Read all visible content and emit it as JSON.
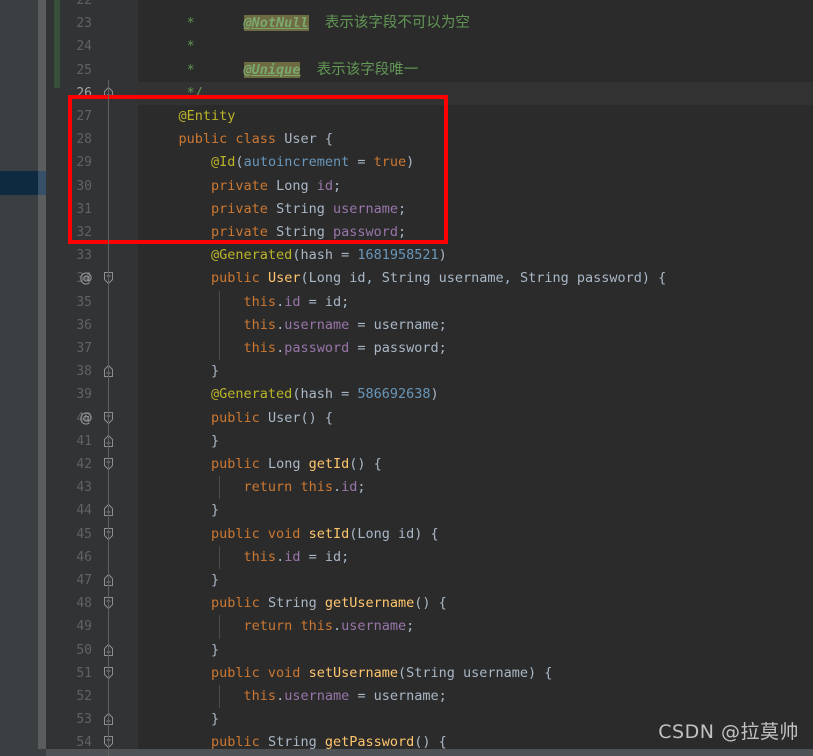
{
  "editor": {
    "theme_name": "darcula",
    "background": "#2b2b2b",
    "gutter_background": "#313335",
    "accent_highlight": "#0e2a41",
    "annotation_box_color": "#fe0000",
    "change_marker_color": "#375039",
    "caret_line_color": "#323232"
  },
  "watermark": {
    "text": "CSDN @拉莫帅"
  },
  "annotation_box": {
    "name": "red-highlight-rectangle",
    "starts_at_line": 27,
    "ends_at_line": 32,
    "color": "#fe0000"
  },
  "lines": [
    {
      "number": "22",
      "at_marker": "",
      "fold": "",
      "caret": false,
      "indent_guides": [],
      "tokens": [
        {
          "text": "     *",
          "cls": "cmt"
        }
      ]
    },
    {
      "number": "23",
      "at_marker": "",
      "fold": "",
      "caret": false,
      "indent_guides": [],
      "tokens": [
        {
          "text": "     *      ",
          "cls": "cmt"
        },
        {
          "text": "@NotNull",
          "cls": "cmt-tag"
        },
        {
          "text": "  ",
          "cls": "cmt"
        },
        {
          "text": "表示该字段不可以为空",
          "cls": "cmt-cjk"
        }
      ]
    },
    {
      "number": "24",
      "at_marker": "",
      "fold": "",
      "caret": false,
      "indent_guides": [],
      "tokens": [
        {
          "text": "     *",
          "cls": "cmt"
        }
      ]
    },
    {
      "number": "25",
      "at_marker": "",
      "fold": "",
      "caret": false,
      "indent_guides": [],
      "tokens": [
        {
          "text": "     *      ",
          "cls": "cmt"
        },
        {
          "text": "@Unique",
          "cls": "cmt-tag"
        },
        {
          "text": "  ",
          "cls": "cmt"
        },
        {
          "text": "表示该字段唯一",
          "cls": "cmt-cjk"
        }
      ]
    },
    {
      "number": "26",
      "at_marker": "",
      "fold": "collapse-end",
      "caret": true,
      "indent_guides": [],
      "tokens": [
        {
          "text": "     */",
          "cls": "cmt"
        }
      ]
    },
    {
      "number": "27",
      "at_marker": "",
      "fold": "",
      "caret": false,
      "indent_guides": [],
      "tokens": [
        {
          "text": "    ",
          "cls": "pln"
        },
        {
          "text": "@Entity",
          "cls": "ann"
        }
      ]
    },
    {
      "number": "28",
      "at_marker": "",
      "fold": "",
      "caret": false,
      "indent_guides": [],
      "tokens": [
        {
          "text": "    ",
          "cls": "pln"
        },
        {
          "text": "public class ",
          "cls": "kw"
        },
        {
          "text": "User ",
          "cls": "typ"
        },
        {
          "text": "{",
          "cls": "pln"
        }
      ]
    },
    {
      "number": "29",
      "at_marker": "",
      "fold": "",
      "caret": false,
      "indent_guides": [],
      "tokens": [
        {
          "text": "        ",
          "cls": "pln"
        },
        {
          "text": "@Id",
          "cls": "ann"
        },
        {
          "text": "(",
          "cls": "pln"
        },
        {
          "text": "autoincrement",
          "cls": "num"
        },
        {
          "text": " = ",
          "cls": "pln"
        },
        {
          "text": "true",
          "cls": "kw"
        },
        {
          "text": ")",
          "cls": "pln"
        }
      ]
    },
    {
      "number": "30",
      "at_marker": "",
      "fold": "",
      "caret": false,
      "indent_guides": [],
      "tokens": [
        {
          "text": "        ",
          "cls": "pln"
        },
        {
          "text": "private ",
          "cls": "kw"
        },
        {
          "text": "Long ",
          "cls": "typ"
        },
        {
          "text": "id",
          "cls": "fld"
        },
        {
          "text": ";",
          "cls": "pln"
        }
      ]
    },
    {
      "number": "31",
      "at_marker": "",
      "fold": "",
      "caret": false,
      "indent_guides": [],
      "tokens": [
        {
          "text": "        ",
          "cls": "pln"
        },
        {
          "text": "private ",
          "cls": "kw"
        },
        {
          "text": "String ",
          "cls": "typ"
        },
        {
          "text": "username",
          "cls": "fld"
        },
        {
          "text": ";",
          "cls": "pln"
        }
      ]
    },
    {
      "number": "32",
      "at_marker": "",
      "fold": "",
      "caret": false,
      "indent_guides": [],
      "tokens": [
        {
          "text": "        ",
          "cls": "pln"
        },
        {
          "text": "private ",
          "cls": "kw"
        },
        {
          "text": "String ",
          "cls": "typ"
        },
        {
          "text": "password",
          "cls": "fld"
        },
        {
          "text": ";",
          "cls": "pln"
        }
      ]
    },
    {
      "number": "33",
      "at_marker": "",
      "fold": "",
      "caret": false,
      "indent_guides": [],
      "tokens": [
        {
          "text": "        ",
          "cls": "pln"
        },
        {
          "text": "@Generated",
          "cls": "ann"
        },
        {
          "text": "(",
          "cls": "pln"
        },
        {
          "text": "hash",
          "cls": "pln"
        },
        {
          "text": " = ",
          "cls": "pln"
        },
        {
          "text": "1681958521",
          "cls": "num"
        },
        {
          "text": ")",
          "cls": "pln"
        }
      ]
    },
    {
      "number": "34",
      "at_marker": "@",
      "fold": "expand-start",
      "caret": false,
      "indent_guides": [],
      "tokens": [
        {
          "text": "        ",
          "cls": "pln"
        },
        {
          "text": "public ",
          "cls": "kw"
        },
        {
          "text": "User",
          "cls": "mth"
        },
        {
          "text": "(",
          "cls": "pln"
        },
        {
          "text": "Long",
          "cls": "typ"
        },
        {
          "text": " id, ",
          "cls": "prm"
        },
        {
          "text": "String",
          "cls": "typ"
        },
        {
          "text": " username, ",
          "cls": "prm"
        },
        {
          "text": "String",
          "cls": "typ"
        },
        {
          "text": " password) {",
          "cls": "prm"
        }
      ]
    },
    {
      "number": "35",
      "at_marker": "",
      "fold": "",
      "caret": false,
      "indent_guides": [
        219
      ],
      "tokens": [
        {
          "text": "            ",
          "cls": "pln"
        },
        {
          "text": "this",
          "cls": "kw"
        },
        {
          "text": ".",
          "cls": "pln"
        },
        {
          "text": "id",
          "cls": "fld"
        },
        {
          "text": " = id;",
          "cls": "pln"
        }
      ]
    },
    {
      "number": "36",
      "at_marker": "",
      "fold": "",
      "caret": false,
      "indent_guides": [
        219
      ],
      "tokens": [
        {
          "text": "            ",
          "cls": "pln"
        },
        {
          "text": "this",
          "cls": "kw"
        },
        {
          "text": ".",
          "cls": "pln"
        },
        {
          "text": "username",
          "cls": "fld"
        },
        {
          "text": " = username;",
          "cls": "pln"
        }
      ]
    },
    {
      "number": "37",
      "at_marker": "",
      "fold": "",
      "caret": false,
      "indent_guides": [
        219
      ],
      "tokens": [
        {
          "text": "            ",
          "cls": "pln"
        },
        {
          "text": "this",
          "cls": "kw"
        },
        {
          "text": ".",
          "cls": "pln"
        },
        {
          "text": "password",
          "cls": "fld"
        },
        {
          "text": " = password;",
          "cls": "pln"
        }
      ]
    },
    {
      "number": "38",
      "at_marker": "",
      "fold": "collapse-end",
      "caret": false,
      "indent_guides": [],
      "tokens": [
        {
          "text": "        }",
          "cls": "pln"
        }
      ]
    },
    {
      "number": "39",
      "at_marker": "",
      "fold": "",
      "caret": false,
      "indent_guides": [],
      "tokens": [
        {
          "text": "        ",
          "cls": "pln"
        },
        {
          "text": "@Generated",
          "cls": "ann"
        },
        {
          "text": "(",
          "cls": "pln"
        },
        {
          "text": "hash",
          "cls": "pln"
        },
        {
          "text": " = ",
          "cls": "pln"
        },
        {
          "text": "586692638",
          "cls": "num"
        },
        {
          "text": ")",
          "cls": "pln"
        }
      ]
    },
    {
      "number": "40",
      "at_marker": "@",
      "fold": "expand-start",
      "caret": false,
      "indent_guides": [],
      "tokens": [
        {
          "text": "        ",
          "cls": "pln"
        },
        {
          "text": "public ",
          "cls": "kw"
        },
        {
          "text": "User",
          "cls": "typ"
        },
        {
          "text": "() {",
          "cls": "pln"
        }
      ]
    },
    {
      "number": "41",
      "at_marker": "",
      "fold": "collapse-end",
      "caret": false,
      "indent_guides": [],
      "tokens": [
        {
          "text": "        }",
          "cls": "pln"
        }
      ]
    },
    {
      "number": "42",
      "at_marker": "",
      "fold": "expand-start",
      "caret": false,
      "indent_guides": [],
      "tokens": [
        {
          "text": "        ",
          "cls": "pln"
        },
        {
          "text": "public ",
          "cls": "kw"
        },
        {
          "text": "Long ",
          "cls": "typ"
        },
        {
          "text": "getId",
          "cls": "mth"
        },
        {
          "text": "() {",
          "cls": "pln"
        }
      ]
    },
    {
      "number": "43",
      "at_marker": "",
      "fold": "",
      "caret": false,
      "indent_guides": [
        219
      ],
      "tokens": [
        {
          "text": "            ",
          "cls": "pln"
        },
        {
          "text": "return this",
          "cls": "kw"
        },
        {
          "text": ".",
          "cls": "pln"
        },
        {
          "text": "id",
          "cls": "fld"
        },
        {
          "text": ";",
          "cls": "pln"
        }
      ]
    },
    {
      "number": "44",
      "at_marker": "",
      "fold": "collapse-end",
      "caret": false,
      "indent_guides": [],
      "tokens": [
        {
          "text": "        }",
          "cls": "pln"
        }
      ]
    },
    {
      "number": "45",
      "at_marker": "",
      "fold": "expand-start",
      "caret": false,
      "indent_guides": [],
      "tokens": [
        {
          "text": "        ",
          "cls": "pln"
        },
        {
          "text": "public void ",
          "cls": "kw"
        },
        {
          "text": "setId",
          "cls": "mth"
        },
        {
          "text": "(",
          "cls": "pln"
        },
        {
          "text": "Long",
          "cls": "typ"
        },
        {
          "text": " id) {",
          "cls": "prm"
        }
      ]
    },
    {
      "number": "46",
      "at_marker": "",
      "fold": "",
      "caret": false,
      "indent_guides": [
        219
      ],
      "tokens": [
        {
          "text": "            ",
          "cls": "pln"
        },
        {
          "text": "this",
          "cls": "kw"
        },
        {
          "text": ".",
          "cls": "pln"
        },
        {
          "text": "id",
          "cls": "fld"
        },
        {
          "text": " = id;",
          "cls": "pln"
        }
      ]
    },
    {
      "number": "47",
      "at_marker": "",
      "fold": "collapse-end",
      "caret": false,
      "indent_guides": [],
      "tokens": [
        {
          "text": "        }",
          "cls": "pln"
        }
      ]
    },
    {
      "number": "48",
      "at_marker": "",
      "fold": "expand-start",
      "caret": false,
      "indent_guides": [],
      "tokens": [
        {
          "text": "        ",
          "cls": "pln"
        },
        {
          "text": "public ",
          "cls": "kw"
        },
        {
          "text": "String ",
          "cls": "typ"
        },
        {
          "text": "getUsername",
          "cls": "mth"
        },
        {
          "text": "() {",
          "cls": "pln"
        }
      ]
    },
    {
      "number": "49",
      "at_marker": "",
      "fold": "",
      "caret": false,
      "indent_guides": [
        219
      ],
      "tokens": [
        {
          "text": "            ",
          "cls": "pln"
        },
        {
          "text": "return this",
          "cls": "kw"
        },
        {
          "text": ".",
          "cls": "pln"
        },
        {
          "text": "username",
          "cls": "fld"
        },
        {
          "text": ";",
          "cls": "pln"
        }
      ]
    },
    {
      "number": "50",
      "at_marker": "",
      "fold": "collapse-end",
      "caret": false,
      "indent_guides": [],
      "tokens": [
        {
          "text": "        }",
          "cls": "pln"
        }
      ]
    },
    {
      "number": "51",
      "at_marker": "",
      "fold": "expand-start",
      "caret": false,
      "indent_guides": [],
      "tokens": [
        {
          "text": "        ",
          "cls": "pln"
        },
        {
          "text": "public void ",
          "cls": "kw"
        },
        {
          "text": "setUsername",
          "cls": "mth"
        },
        {
          "text": "(",
          "cls": "pln"
        },
        {
          "text": "String",
          "cls": "typ"
        },
        {
          "text": " username) {",
          "cls": "prm"
        }
      ]
    },
    {
      "number": "52",
      "at_marker": "",
      "fold": "",
      "caret": false,
      "indent_guides": [
        219
      ],
      "tokens": [
        {
          "text": "            ",
          "cls": "pln"
        },
        {
          "text": "this",
          "cls": "kw"
        },
        {
          "text": ".",
          "cls": "pln"
        },
        {
          "text": "username",
          "cls": "fld"
        },
        {
          "text": " = username;",
          "cls": "pln"
        }
      ]
    },
    {
      "number": "53",
      "at_marker": "",
      "fold": "collapse-end",
      "caret": false,
      "indent_guides": [],
      "tokens": [
        {
          "text": "        }",
          "cls": "pln"
        }
      ]
    },
    {
      "number": "54",
      "at_marker": "",
      "fold": "expand-start",
      "caret": false,
      "indent_guides": [],
      "tokens": [
        {
          "text": "        ",
          "cls": "pln"
        },
        {
          "text": "public ",
          "cls": "kw"
        },
        {
          "text": "String ",
          "cls": "typ"
        },
        {
          "text": "getPassword",
          "cls": "mth"
        },
        {
          "text": "() {",
          "cls": "pln"
        }
      ]
    }
  ]
}
